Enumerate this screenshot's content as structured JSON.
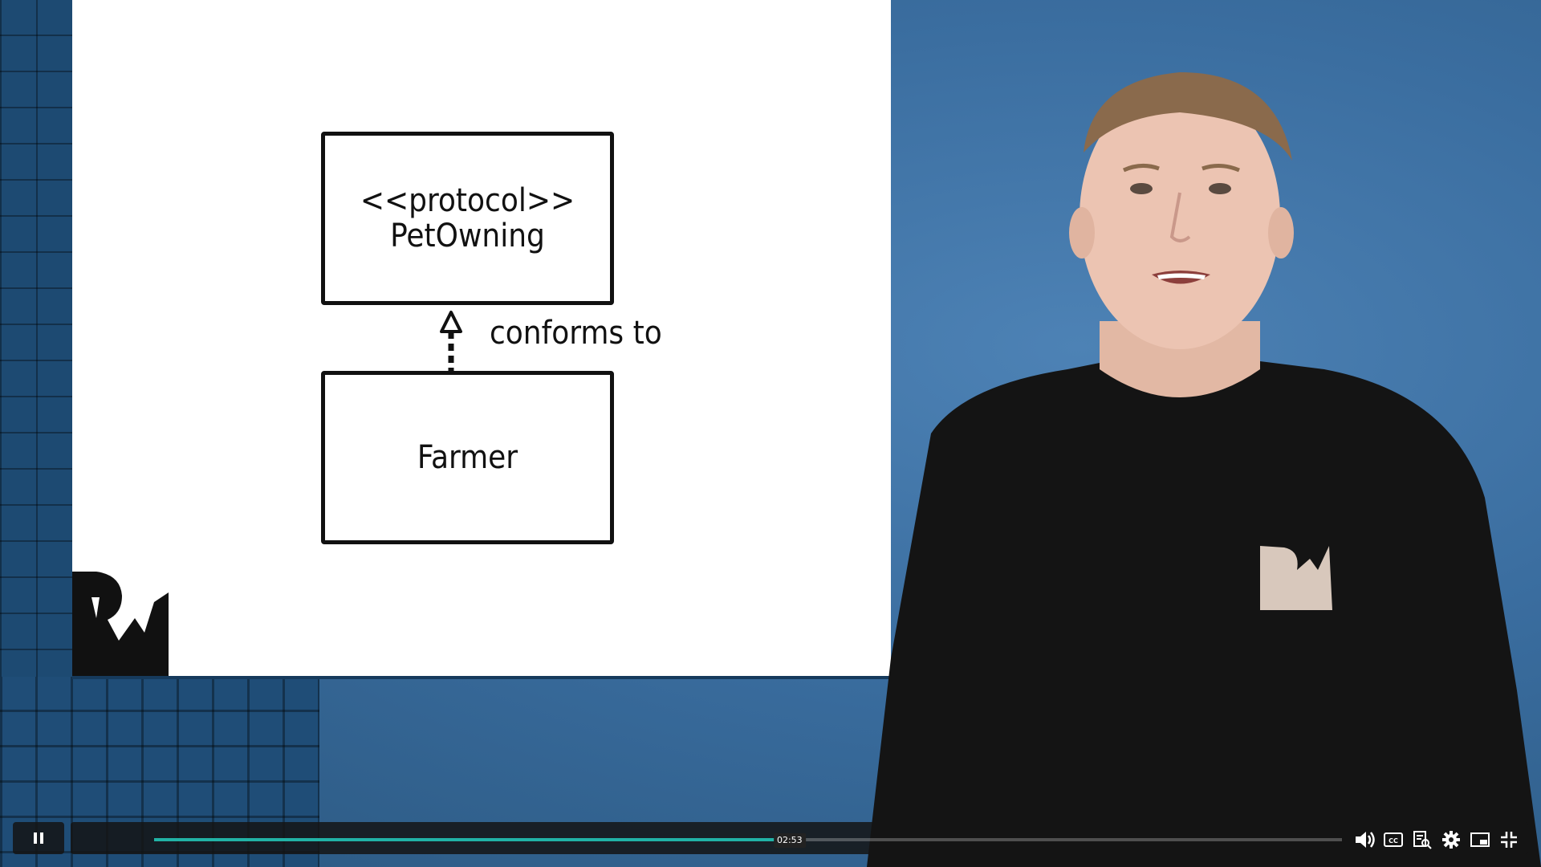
{
  "slide": {
    "protocol_box": {
      "stereotype": "<<protocol>>",
      "name": "PetOwning"
    },
    "farmer_box": {
      "name": "Farmer"
    },
    "relationship_label": "conforms to"
  },
  "player": {
    "current_time": "02:53",
    "progress_fraction": 0.535,
    "accent_color": "#21b2a6",
    "controls": {
      "play_pause_icon": "pause-icon",
      "volume_icon": "volume-icon",
      "captions_icon": "cc-icon",
      "transcript_icon": "transcript-icon",
      "settings_icon": "gear-icon",
      "pip_icon": "picture-in-picture-icon",
      "fullscreen_icon": "exit-fullscreen-icon"
    }
  }
}
